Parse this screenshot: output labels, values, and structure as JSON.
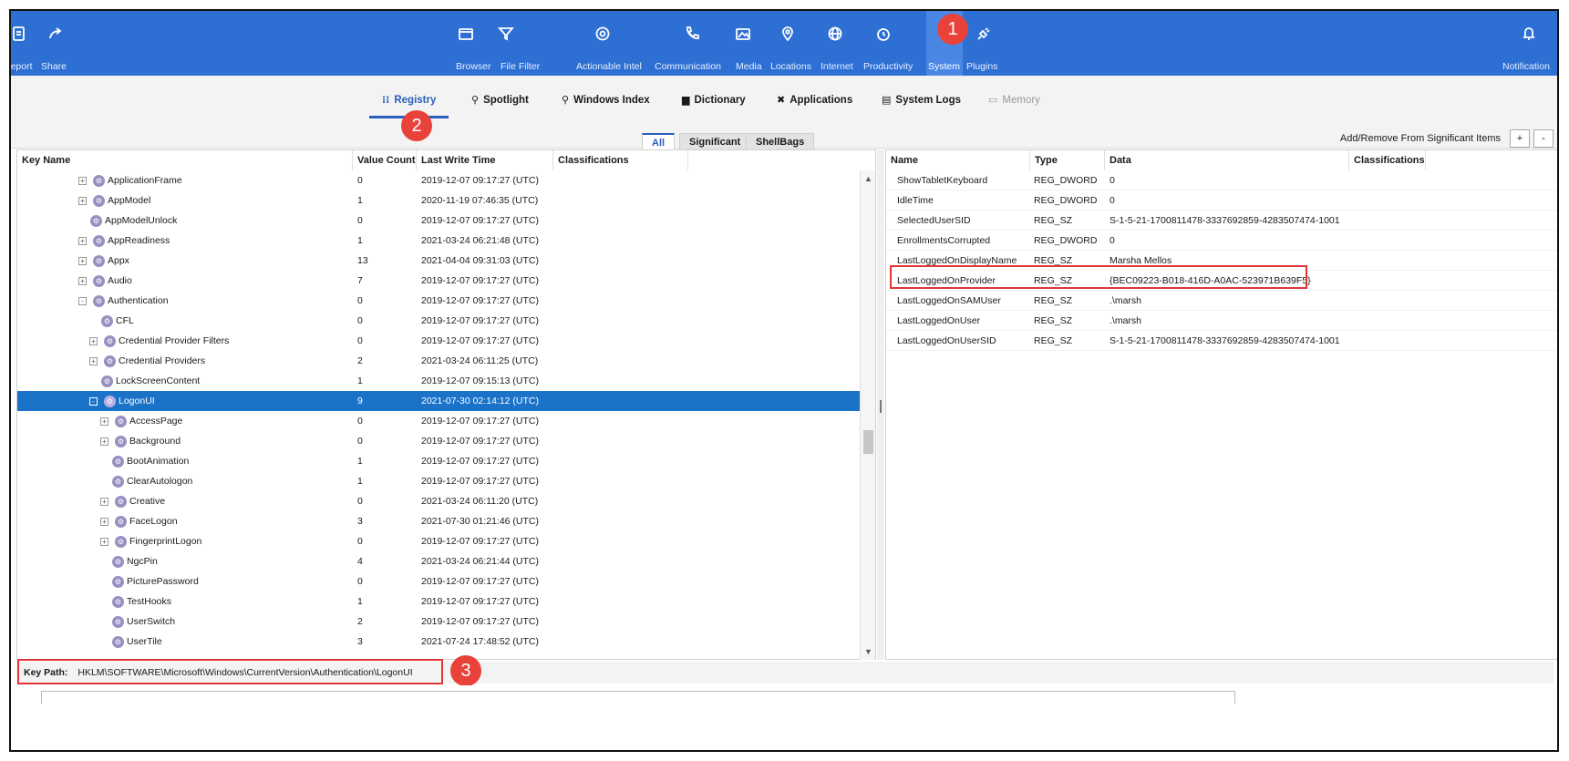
{
  "ribbon": {
    "left_items": [
      {
        "label": "Report",
        "icon": "report-icon"
      },
      {
        "label": "Share",
        "icon": "share-icon"
      }
    ],
    "center_items": [
      {
        "label": "Browser",
        "icon": "browser-icon"
      },
      {
        "label": "File Filter",
        "icon": "filter-icon"
      },
      {
        "label": "Actionable Intel",
        "icon": "intel-icon"
      },
      {
        "label": "Communication",
        "icon": "phone-icon"
      },
      {
        "label": "Media",
        "icon": "media-icon"
      },
      {
        "label": "Locations",
        "icon": "location-icon"
      },
      {
        "label": "Internet",
        "icon": "globe-icon"
      },
      {
        "label": "Productivity",
        "icon": "clock-icon"
      },
      {
        "label": "System",
        "icon": "gear-icon"
      },
      {
        "label": "Plugins",
        "icon": "plug-icon"
      }
    ],
    "right_item": {
      "label": "Notification",
      "icon": "bell-icon"
    },
    "active": "System"
  },
  "callouts": [
    "1",
    "2",
    "3"
  ],
  "view_tabs": [
    {
      "label": "Registry",
      "icon": "registry-icon",
      "active": true
    },
    {
      "label": "Spotlight",
      "icon": "search-icon"
    },
    {
      "label": "Windows Index",
      "icon": "search-icon"
    },
    {
      "label": "Dictionary",
      "icon": "book-icon"
    },
    {
      "label": "Applications",
      "icon": "x-icon"
    },
    {
      "label": "System Logs",
      "icon": "printer-icon"
    },
    {
      "label": "Memory",
      "icon": "memory-icon",
      "disabled": true
    }
  ],
  "filters": {
    "all": "All",
    "significant": "Significant",
    "shellbags": "ShellBags"
  },
  "add_remove_label": "Add/Remove From Significant Items",
  "mini_buttons": {
    "plus": "+",
    "minus": "-"
  },
  "left_table": {
    "headers": {
      "key_name": "Key Name",
      "value_count": "Value Count",
      "last_write": "Last Write Time",
      "classifications": "Classifications"
    },
    "rows": [
      {
        "name": "ApplicationFrame",
        "count": "0",
        "time": "2019-12-07 09:17:27 (UTC)",
        "indent": 0,
        "expandable": "+"
      },
      {
        "name": "AppModel",
        "count": "1",
        "time": "2020-11-19 07:46:35 (UTC)",
        "indent": 0,
        "expandable": "+"
      },
      {
        "name": "AppModelUnlock",
        "count": "0",
        "time": "2019-12-07 09:17:27 (UTC)",
        "indent": 0,
        "expandable": ""
      },
      {
        "name": "AppReadiness",
        "count": "1",
        "time": "2021-03-24 06:21:48 (UTC)",
        "indent": 0,
        "expandable": "+"
      },
      {
        "name": "Appx",
        "count": "13",
        "time": "2021-04-04 09:31:03 (UTC)",
        "indent": 0,
        "expandable": "+"
      },
      {
        "name": "Audio",
        "count": "7",
        "time": "2019-12-07 09:17:27 (UTC)",
        "indent": 0,
        "expandable": "+"
      },
      {
        "name": "Authentication",
        "count": "0",
        "time": "2019-12-07 09:17:27 (UTC)",
        "indent": 0,
        "expandable": "-"
      },
      {
        "name": "CFL",
        "count": "0",
        "time": "2019-12-07 09:17:27 (UTC)",
        "indent": 1,
        "expandable": ""
      },
      {
        "name": "Credential Provider Filters",
        "count": "0",
        "time": "2019-12-07 09:17:27 (UTC)",
        "indent": 1,
        "expandable": "+"
      },
      {
        "name": "Credential Providers",
        "count": "2",
        "time": "2021-03-24 06:11:25 (UTC)",
        "indent": 1,
        "expandable": "+"
      },
      {
        "name": "LockScreenContent",
        "count": "1",
        "time": "2019-12-07 09:15:13 (UTC)",
        "indent": 1,
        "expandable": ""
      },
      {
        "name": "LogonUI",
        "count": "9",
        "time": "2021-07-30 02:14:12 (UTC)",
        "indent": 1,
        "expandable": "-",
        "selected": true
      },
      {
        "name": "AccessPage",
        "count": "0",
        "time": "2019-12-07 09:17:27 (UTC)",
        "indent": 2,
        "expandable": "+"
      },
      {
        "name": "Background",
        "count": "0",
        "time": "2019-12-07 09:17:27 (UTC)",
        "indent": 2,
        "expandable": "+"
      },
      {
        "name": "BootAnimation",
        "count": "1",
        "time": "2019-12-07 09:17:27 (UTC)",
        "indent": 2,
        "expandable": ""
      },
      {
        "name": "ClearAutologon",
        "count": "1",
        "time": "2019-12-07 09:17:27 (UTC)",
        "indent": 2,
        "expandable": ""
      },
      {
        "name": "Creative",
        "count": "0",
        "time": "2021-03-24 06:11:20 (UTC)",
        "indent": 2,
        "expandable": "+"
      },
      {
        "name": "FaceLogon",
        "count": "3",
        "time": "2021-07-30 01:21:46 (UTC)",
        "indent": 2,
        "expandable": "+"
      },
      {
        "name": "FingerprintLogon",
        "count": "0",
        "time": "2019-12-07 09:17:27 (UTC)",
        "indent": 2,
        "expandable": "+"
      },
      {
        "name": "NgcPin",
        "count": "4",
        "time": "2021-03-24 06:21:44 (UTC)",
        "indent": 2,
        "expandable": ""
      },
      {
        "name": "PicturePassword",
        "count": "0",
        "time": "2019-12-07 09:17:27 (UTC)",
        "indent": 2,
        "expandable": ""
      },
      {
        "name": "TestHooks",
        "count": "1",
        "time": "2019-12-07 09:17:27 (UTC)",
        "indent": 2,
        "expandable": ""
      },
      {
        "name": "UserSwitch",
        "count": "2",
        "time": "2019-12-07 09:17:27 (UTC)",
        "indent": 2,
        "expandable": ""
      },
      {
        "name": "UserTile",
        "count": "3",
        "time": "2021-07-24 17:48:52 (UTC)",
        "indent": 2,
        "expandable": ""
      }
    ]
  },
  "right_table": {
    "headers": {
      "name": "Name",
      "type": "Type",
      "data": "Data",
      "classifications": "Classifications"
    },
    "rows": [
      {
        "name": "ShowTabletKeyboard",
        "type": "REG_DWORD",
        "data": "0"
      },
      {
        "name": "IdleTime",
        "type": "REG_DWORD",
        "data": "0"
      },
      {
        "name": "SelectedUserSID",
        "type": "REG_SZ",
        "data": "S-1-5-21-1700811478-3337692859-4283507474-1001"
      },
      {
        "name": "EnrollmentsCorrupted",
        "type": "REG_DWORD",
        "data": "0"
      },
      {
        "name": "LastLoggedOnDisplayName",
        "type": "REG_SZ",
        "data": "Marsha Mellos"
      },
      {
        "name": "LastLoggedOnProvider",
        "type": "REG_SZ",
        "data": "{BEC09223-B018-416D-A0AC-523971B639F5}",
        "highlighted": true
      },
      {
        "name": "LastLoggedOnSAMUser",
        "type": "REG_SZ",
        "data": ".\\marsh"
      },
      {
        "name": "LastLoggedOnUser",
        "type": "REG_SZ",
        "data": ".\\marsh"
      },
      {
        "name": "LastLoggedOnUserSID",
        "type": "REG_SZ",
        "data": "S-1-5-21-1700811478-3337692859-4283507474-1001"
      }
    ]
  },
  "key_path": {
    "label": "Key Path:",
    "value": "HKLM\\SOFTWARE\\Microsoft\\Windows\\CurrentVersion\\Authentication\\LogonUI"
  },
  "colors": {
    "ribbon": "#2e6fd4",
    "selection": "#1a73c9",
    "callout": "#e8423a",
    "accent": "#2a5fbd"
  }
}
